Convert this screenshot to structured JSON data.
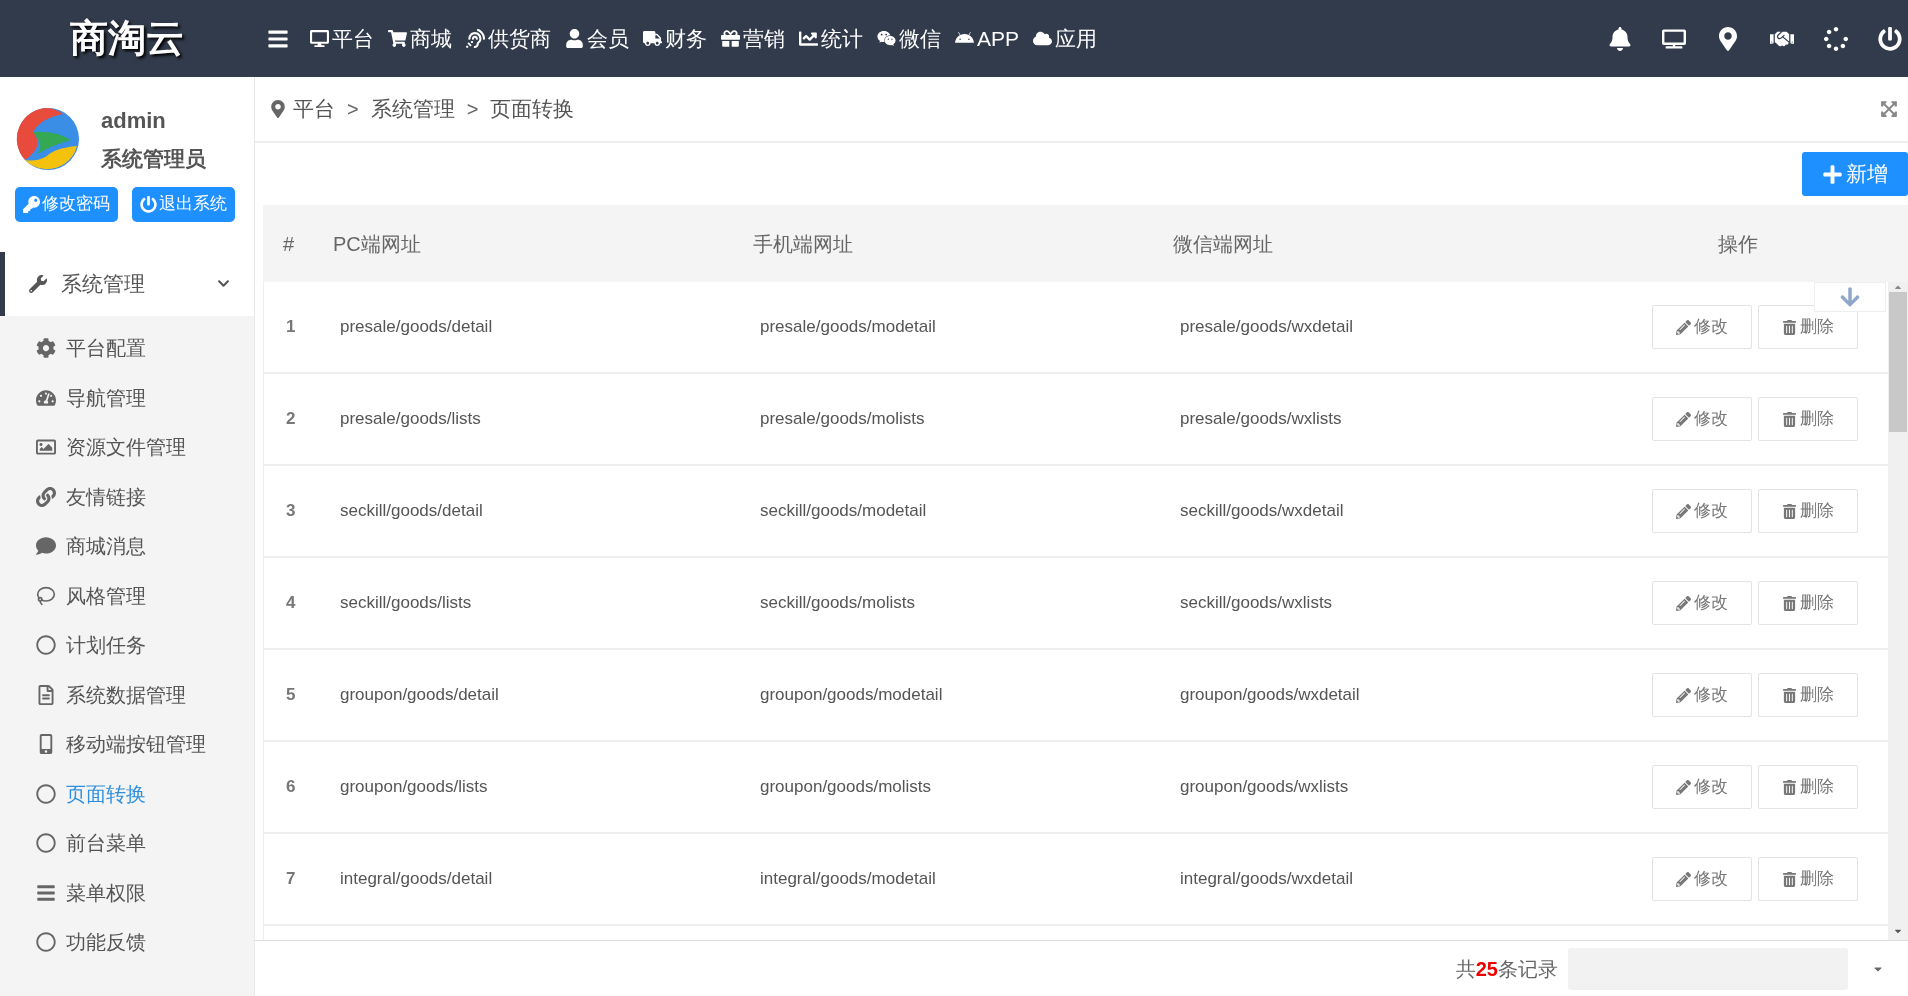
{
  "brand": "商淘云",
  "nav": [
    "平台",
    "商城",
    "供货商",
    "会员",
    "财务",
    "营销",
    "统计",
    "微信",
    "APP",
    "应用"
  ],
  "user": {
    "name": "admin",
    "role": "系统管理员"
  },
  "user_buttons": [
    "修改密码",
    "退出系统"
  ],
  "menu": {
    "label": "系统管理",
    "expanded": true,
    "children": [
      {
        "label": "平台配置",
        "selected": false
      },
      {
        "label": "导航管理",
        "selected": false
      },
      {
        "label": "资源文件管理",
        "selected": false
      },
      {
        "label": "友情链接",
        "selected": false
      },
      {
        "label": "商城消息",
        "selected": false
      },
      {
        "label": "风格管理",
        "selected": false
      },
      {
        "label": "计划任务",
        "selected": false
      },
      {
        "label": "系统数据管理",
        "selected": false
      },
      {
        "label": "移动端按钮管理",
        "selected": false
      },
      {
        "label": "页面转换",
        "selected": true
      },
      {
        "label": "前台菜单",
        "selected": false
      },
      {
        "label": "菜单权限",
        "selected": false
      },
      {
        "label": "功能反馈",
        "selected": false
      }
    ]
  },
  "breadcrumb": [
    "平台",
    "系统管理",
    "页面转换"
  ],
  "breadcrumb_separator": ">",
  "add_button": "新增",
  "table": {
    "columns": [
      "#",
      "PC端网址",
      "手机端网址",
      "微信端网址",
      "操作"
    ],
    "rows": [
      {
        "cells": [
          "1",
          "presale/goods/detail",
          "presale/goods/modetail",
          "presale/goods/wxdetail"
        ],
        "actions": [
          "修改",
          "删除"
        ]
      },
      {
        "cells": [
          "2",
          "presale/goods/lists",
          "presale/goods/molists",
          "presale/goods/wxlists"
        ],
        "actions": [
          "修改",
          "删除"
        ]
      },
      {
        "cells": [
          "3",
          "seckill/goods/detail",
          "seckill/goods/modetail",
          "seckill/goods/wxdetail"
        ],
        "actions": [
          "修改",
          "删除"
        ]
      },
      {
        "cells": [
          "4",
          "seckill/goods/lists",
          "seckill/goods/molists",
          "seckill/goods/wxlists"
        ],
        "actions": [
          "修改",
          "删除"
        ]
      },
      {
        "cells": [
          "5",
          "groupon/goods/detail",
          "groupon/goods/modetail",
          "groupon/goods/wxdetail"
        ],
        "actions": [
          "修改",
          "删除"
        ]
      },
      {
        "cells": [
          "6",
          "groupon/goods/lists",
          "groupon/goods/molists",
          "groupon/goods/wxlists"
        ],
        "actions": [
          "修改",
          "删除"
        ]
      },
      {
        "cells": [
          "7",
          "integral/goods/detail",
          "integral/goods/modetail",
          "integral/goods/wxdetail"
        ],
        "actions": [
          "修改",
          "删除"
        ]
      }
    ]
  },
  "footer": {
    "record_count": "共**25**条记录"
  }
}
